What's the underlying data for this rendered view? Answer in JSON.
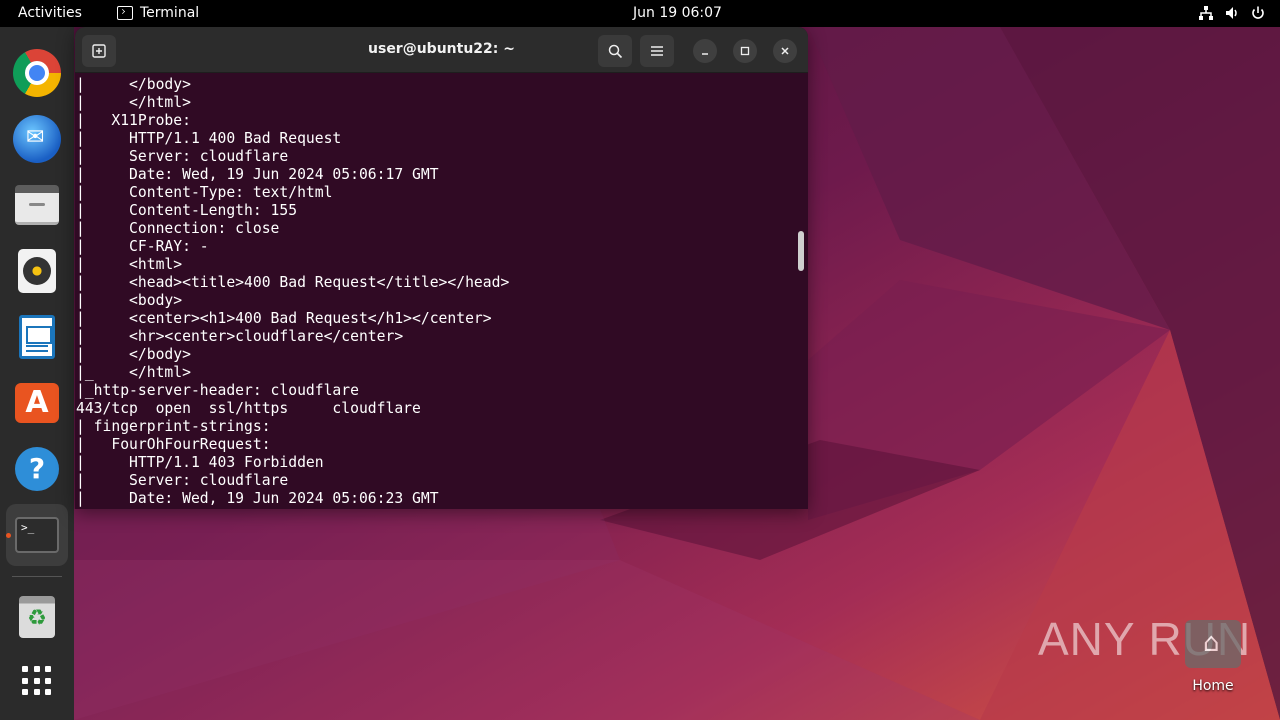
{
  "topbar": {
    "activities": "Activities",
    "app_name": "Terminal",
    "clock": "Jun 19  06:07"
  },
  "dock": {
    "items": [
      "Google Chrome",
      "Thunderbird Mail",
      "Files",
      "Rhythmbox",
      "LibreOffice Writer",
      "Ubuntu Software",
      "Help",
      "Terminal",
      "Trash",
      "Show Applications"
    ],
    "terminal_glyph": ">_"
  },
  "terminal": {
    "title": "user@ubuntu22: ~",
    "lines": [
      "|     </body>",
      "|     </html>",
      "|   X11Probe:",
      "|     HTTP/1.1 400 Bad Request",
      "|     Server: cloudflare",
      "|     Date: Wed, 19 Jun 2024 05:06:17 GMT",
      "|     Content-Type: text/html",
      "|     Content-Length: 155",
      "|     Connection: close",
      "|     CF-RAY: -",
      "|     <html>",
      "|     <head><title>400 Bad Request</title></head>",
      "|     <body>",
      "|     <center><h1>400 Bad Request</h1></center>",
      "|     <hr><center>cloudflare</center>",
      "|     </body>",
      "|_    </html>",
      "|_http-server-header: cloudflare",
      "443/tcp  open  ssl/https     cloudflare",
      "| fingerprint-strings:",
      "|   FourOhFourRequest:",
      "|     HTTP/1.1 403 Forbidden",
      "|     Server: cloudflare",
      "|     Date: Wed, 19 Jun 2024 05:06:23 GMT",
      "|"
    ]
  },
  "desktop": {
    "home_label": "Home",
    "watermark": "ANY RUN"
  },
  "colors": {
    "terminal_bg": "#300a24",
    "header_bg": "#2c2c2c",
    "accent": "#e95420"
  }
}
